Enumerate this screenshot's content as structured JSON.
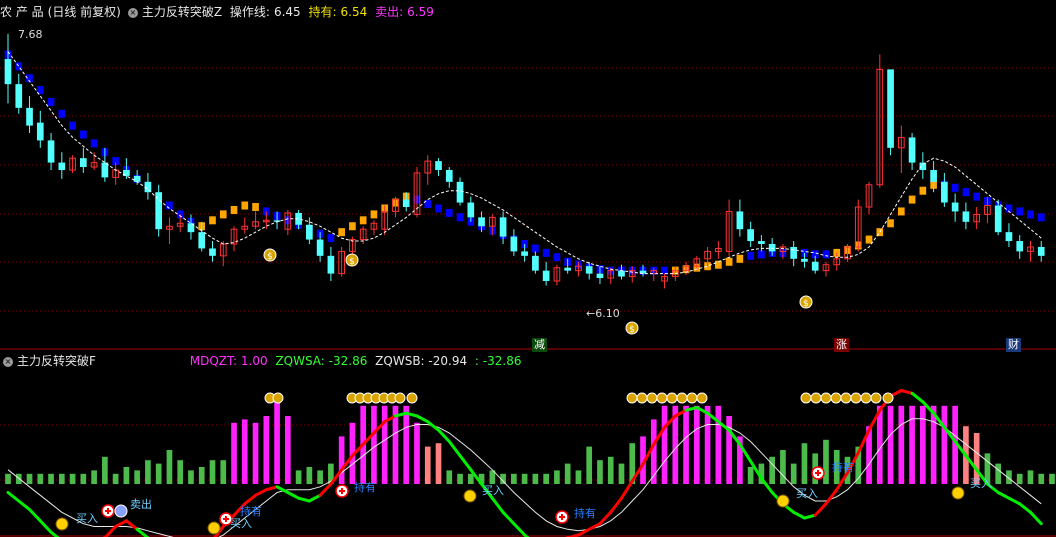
{
  "main_header": {
    "symbol": "农 产 品",
    "period": "(日线 前复权)",
    "indicator": "主力反转突破Z",
    "op_label": "操作线:",
    "op_value": "6.45",
    "hold_label": "持有:",
    "hold_value": "6.54",
    "sell_label": "卖出:",
    "sell_value": "6.59"
  },
  "sub_header": {
    "indicator": "主力反转突破F",
    "mdqzt": "MDQZT: 1.00",
    "zqwsa": "ZQWSA: -32.86",
    "zqwsb": "ZQWSB: -20.94",
    "extra": ": -32.86"
  },
  "annotations": {
    "high_price": "7.68",
    "low_price": "←6.10",
    "event_tags": [
      "减",
      "涨",
      "财"
    ],
    "buy": "买入",
    "sell": "卖出",
    "hold": "持有"
  },
  "colors": {
    "up": "#ff3333",
    "down": "#54ffff",
    "band_blue": "#0000ff",
    "band_orange": "#ffa500",
    "osc_red": "#ff0000",
    "osc_green": "#00ee00",
    "bar_green": "#4cbb4c",
    "bar_magenta": "#ff22ff",
    "bar_pink": "#ff8080",
    "grid": "#7a0000"
  },
  "chart_data": [
    {
      "type": "candlestick",
      "title": "主力反转突破Z",
      "ylim": [
        5.8,
        7.8
      ],
      "candles": [
        [
          7.55,
          7.72,
          7.25,
          7.38
        ],
        [
          7.38,
          7.45,
          7.18,
          7.22
        ],
        [
          7.22,
          7.3,
          7.05,
          7.1
        ],
        [
          7.12,
          7.2,
          6.95,
          7.0
        ],
        [
          7.0,
          7.05,
          6.8,
          6.85
        ],
        [
          6.85,
          6.92,
          6.74,
          6.8
        ],
        [
          6.8,
          6.9,
          6.78,
          6.88
        ],
        [
          6.88,
          6.95,
          6.78,
          6.82
        ],
        [
          6.82,
          6.92,
          6.8,
          6.85
        ],
        [
          6.85,
          6.95,
          6.72,
          6.75
        ],
        [
          6.75,
          6.85,
          6.7,
          6.8
        ],
        [
          6.8,
          6.88,
          6.74,
          6.76
        ],
        [
          6.76,
          6.8,
          6.7,
          6.72
        ],
        [
          6.72,
          6.78,
          6.6,
          6.65
        ],
        [
          6.65,
          6.7,
          6.35,
          6.4
        ],
        [
          6.4,
          6.48,
          6.3,
          6.42
        ],
        [
          6.42,
          6.5,
          6.38,
          6.44
        ],
        [
          6.44,
          6.5,
          6.33,
          6.38
        ],
        [
          6.38,
          6.45,
          6.25,
          6.27
        ],
        [
          6.27,
          6.32,
          6.18,
          6.22
        ],
        [
          6.22,
          6.32,
          6.15,
          6.3
        ],
        [
          6.3,
          6.42,
          6.25,
          6.4
        ],
        [
          6.4,
          6.48,
          6.37,
          6.42
        ],
        [
          6.42,
          6.52,
          6.4,
          6.45
        ],
        [
          6.45,
          6.52,
          6.4,
          6.46
        ],
        [
          6.46,
          6.52,
          6.4,
          6.45
        ],
        [
          6.4,
          6.53,
          6.36,
          6.51
        ],
        [
          6.51,
          6.53,
          6.4,
          6.43
        ],
        [
          6.43,
          6.48,
          6.3,
          6.33
        ],
        [
          6.33,
          6.38,
          6.18,
          6.22
        ],
        [
          6.22,
          6.28,
          6.05,
          6.1
        ],
        [
          6.1,
          6.28,
          6.08,
          6.25
        ],
        [
          6.25,
          6.35,
          6.22,
          6.33
        ],
        [
          6.33,
          6.42,
          6.3,
          6.4
        ],
        [
          6.4,
          6.46,
          6.36,
          6.44
        ],
        [
          6.4,
          6.56,
          6.36,
          6.52
        ],
        [
          6.52,
          6.62,
          6.48,
          6.6
        ],
        [
          6.6,
          6.65,
          6.52,
          6.55
        ],
        [
          6.5,
          6.82,
          6.48,
          6.78
        ],
        [
          6.78,
          6.9,
          6.7,
          6.86
        ],
        [
          6.86,
          6.88,
          6.76,
          6.8
        ],
        [
          6.8,
          6.82,
          6.68,
          6.72
        ],
        [
          6.72,
          6.75,
          6.56,
          6.58
        ],
        [
          6.58,
          6.62,
          6.45,
          6.48
        ],
        [
          6.48,
          6.52,
          6.38,
          6.42
        ],
        [
          6.42,
          6.5,
          6.36,
          6.48
        ],
        [
          6.48,
          6.52,
          6.3,
          6.35
        ],
        [
          6.35,
          6.4,
          6.22,
          6.25
        ],
        [
          6.25,
          6.3,
          6.18,
          6.22
        ],
        [
          6.22,
          6.25,
          6.1,
          6.12
        ],
        [
          6.12,
          6.18,
          6.02,
          6.05
        ],
        [
          6.05,
          6.16,
          6.02,
          6.14
        ],
        [
          6.14,
          6.2,
          6.1,
          6.12
        ],
        [
          6.12,
          6.18,
          6.08,
          6.15
        ],
        [
          6.15,
          6.18,
          6.06,
          6.1
        ],
        [
          6.1,
          6.15,
          6.03,
          6.07
        ],
        [
          6.07,
          6.14,
          6.03,
          6.12
        ],
        [
          6.12,
          6.16,
          6.06,
          6.08
        ],
        [
          6.08,
          6.15,
          6.04,
          6.12
        ],
        [
          6.12,
          6.16,
          6.08,
          6.1
        ],
        [
          6.1,
          6.14,
          6.05,
          6.12
        ],
        [
          6.05,
          6.1,
          6.0,
          6.08
        ],
        [
          6.08,
          6.15,
          6.05,
          6.12
        ],
        [
          6.12,
          6.18,
          6.09,
          6.15
        ],
        [
          6.15,
          6.22,
          6.12,
          6.2
        ],
        [
          6.2,
          6.28,
          6.15,
          6.25
        ],
        [
          6.25,
          6.32,
          6.2,
          6.27
        ],
        [
          6.25,
          6.6,
          6.22,
          6.52
        ],
        [
          6.52,
          6.6,
          6.35,
          6.4
        ],
        [
          6.4,
          6.45,
          6.28,
          6.32
        ],
        [
          6.32,
          6.36,
          6.25,
          6.3
        ],
        [
          6.3,
          6.34,
          6.22,
          6.25
        ],
        [
          6.25,
          6.3,
          6.2,
          6.28
        ],
        [
          6.28,
          6.32,
          6.15,
          6.2
        ],
        [
          6.2,
          6.24,
          6.14,
          6.18
        ],
        [
          6.18,
          6.22,
          6.1,
          6.12
        ],
        [
          6.12,
          6.18,
          6.08,
          6.16
        ],
        [
          6.16,
          6.24,
          6.12,
          6.2
        ],
        [
          6.2,
          6.3,
          6.18,
          6.28
        ],
        [
          6.28,
          6.6,
          6.25,
          6.55
        ],
        [
          6.55,
          6.72,
          6.5,
          6.7
        ],
        [
          6.7,
          7.58,
          6.68,
          7.48
        ],
        [
          7.48,
          7.4,
          6.9,
          6.95
        ],
        [
          6.95,
          7.1,
          6.78,
          7.02
        ],
        [
          7.02,
          7.05,
          6.8,
          6.85
        ],
        [
          6.85,
          6.92,
          6.74,
          6.8
        ],
        [
          6.8,
          6.86,
          6.65,
          6.72
        ],
        [
          6.72,
          6.78,
          6.55,
          6.58
        ],
        [
          6.58,
          6.64,
          6.45,
          6.52
        ],
        [
          6.52,
          6.58,
          6.4,
          6.45
        ],
        [
          6.45,
          6.55,
          6.4,
          6.5
        ],
        [
          6.5,
          6.62,
          6.44,
          6.56
        ],
        [
          6.56,
          6.6,
          6.36,
          6.38
        ],
        [
          6.38,
          6.44,
          6.28,
          6.32
        ],
        [
          6.32,
          6.36,
          6.2,
          6.25
        ],
        [
          6.25,
          6.32,
          6.18,
          6.28
        ],
        [
          6.28,
          6.32,
          6.18,
          6.22
        ]
      ],
      "band": [
        7.58,
        7.5,
        7.42,
        7.34,
        7.26,
        7.18,
        7.1,
        7.04,
        6.98,
        6.92,
        6.86,
        6.8,
        6.74,
        6.68,
        6.62,
        6.56,
        6.5,
        6.45,
        6.42,
        6.46,
        6.5,
        6.53,
        6.56,
        6.55,
        6.52,
        6.49,
        6.46,
        6.43,
        6.4,
        6.37,
        6.34,
        6.38,
        6.42,
        6.46,
        6.5,
        6.54,
        6.58,
        6.62,
        6.6,
        6.57,
        6.54,
        6.51,
        6.48,
        6.45,
        6.42,
        6.39,
        6.36,
        6.33,
        6.3,
        6.27,
        6.24,
        6.21,
        6.18,
        6.16,
        6.14,
        6.13,
        6.12,
        6.12,
        6.12,
        6.12,
        6.12,
        6.12,
        6.12,
        6.13,
        6.14,
        6.15,
        6.16,
        6.18,
        6.2,
        6.22,
        6.23,
        6.24,
        6.24,
        6.24,
        6.24,
        6.23,
        6.23,
        6.24,
        6.26,
        6.29,
        6.33,
        6.38,
        6.44,
        6.52,
        6.6,
        6.66,
        6.7,
        6.7,
        6.68,
        6.65,
        6.62,
        6.59,
        6.56,
        6.54,
        6.52,
        6.5,
        6.48
      ],
      "band_mode": [
        -1,
        -1,
        -1,
        -1,
        -1,
        -1,
        -1,
        -1,
        -1,
        -1,
        -1,
        -1,
        -1,
        -1,
        -1,
        -1,
        -1,
        -1,
        1,
        1,
        1,
        1,
        1,
        1,
        -1,
        -1,
        -1,
        -1,
        -1,
        -1,
        -1,
        1,
        1,
        1,
        1,
        1,
        1,
        1,
        -1,
        -1,
        -1,
        -1,
        -1,
        -1,
        -1,
        -1,
        -1,
        -1,
        -1,
        -1,
        -1,
        -1,
        -1,
        -1,
        -1,
        -1,
        -1,
        -1,
        -1,
        -1,
        -1,
        -1,
        1,
        1,
        1,
        1,
        1,
        1,
        1,
        -1,
        -1,
        -1,
        -1,
        -1,
        -1,
        -1,
        -1,
        1,
        1,
        1,
        1,
        1,
        1,
        1,
        1,
        1,
        1,
        -1,
        -1,
        -1,
        -1,
        -1,
        -1,
        -1,
        -1,
        -1,
        -1
      ],
      "ma": [
        7.6,
        7.5,
        7.4,
        7.3,
        7.2,
        7.1,
        7.02,
        6.96,
        6.9,
        6.85,
        6.8,
        6.76,
        6.72,
        6.67,
        6.6,
        6.54,
        6.49,
        6.44,
        6.39,
        6.34,
        6.3,
        6.31,
        6.34,
        6.38,
        6.42,
        6.45,
        6.47,
        6.47,
        6.45,
        6.42,
        6.38,
        6.34,
        6.32,
        6.32,
        6.34,
        6.38,
        6.43,
        6.48,
        6.54,
        6.6,
        6.64,
        6.66,
        6.66,
        6.64,
        6.61,
        6.57,
        6.53,
        6.48,
        6.43,
        6.38,
        6.33,
        6.28,
        6.24,
        6.2,
        6.17,
        6.15,
        6.13,
        6.12,
        6.11,
        6.1,
        6.1,
        6.1,
        6.1,
        6.11,
        6.13,
        6.15,
        6.18,
        6.21,
        6.24,
        6.26,
        6.27,
        6.27,
        6.27,
        6.26,
        6.25,
        6.24,
        6.22,
        6.21,
        6.21,
        6.23,
        6.28,
        6.38,
        6.5,
        6.62,
        6.74,
        6.84,
        6.88,
        6.86,
        6.82,
        6.76,
        6.7,
        6.64,
        6.58,
        6.52,
        6.46,
        6.4,
        6.34
      ],
      "annotations": [
        "7.68",
        "←6.10"
      ]
    },
    {
      "type": "bar",
      "title": "主力反转突破F",
      "ylim": [
        -100,
        100
      ],
      "bars": [
        6,
        6,
        6,
        6,
        6,
        6,
        6,
        6,
        8,
        16,
        6,
        10,
        8,
        14,
        12,
        20,
        14,
        8,
        10,
        14,
        14,
        36,
        38,
        36,
        40,
        50,
        40,
        8,
        10,
        8,
        12,
        28,
        36,
        46,
        46,
        46,
        46,
        46,
        36,
        22,
        24,
        8,
        6,
        6,
        6,
        8,
        6,
        6,
        6,
        6,
        6,
        8,
        12,
        8,
        22,
        14,
        16,
        12,
        24,
        28,
        38,
        46,
        46,
        46,
        46,
        46,
        46,
        40,
        28,
        10,
        12,
        16,
        20,
        12,
        24,
        18,
        26,
        20,
        16,
        22,
        34,
        46,
        46,
        46,
        46,
        46,
        46,
        46,
        46,
        34,
        30,
        18,
        12,
        8,
        6,
        8,
        6,
        6
      ],
      "bar_kind": [
        0,
        0,
        0,
        0,
        0,
        0,
        0,
        0,
        0,
        0,
        0,
        0,
        0,
        0,
        0,
        0,
        0,
        0,
        0,
        0,
        0,
        1,
        1,
        1,
        1,
        1,
        1,
        0,
        0,
        0,
        0,
        1,
        1,
        1,
        1,
        1,
        1,
        1,
        1,
        2,
        2,
        0,
        0,
        0,
        0,
        0,
        0,
        0,
        0,
        0,
        0,
        0,
        0,
        0,
        0,
        0,
        0,
        0,
        0,
        1,
        1,
        1,
        1,
        1,
        1,
        1,
        1,
        1,
        1,
        0,
        0,
        0,
        0,
        0,
        0,
        0,
        0,
        0,
        0,
        0,
        1,
        1,
        1,
        1,
        1,
        1,
        1,
        1,
        1,
        2,
        2,
        0,
        0,
        0,
        0,
        0,
        0,
        0
      ],
      "osc": [
        -6,
        -12,
        -18,
        -26,
        -34,
        -40,
        -44,
        -46,
        -42,
        -38,
        -30,
        -26,
        -32,
        -38,
        -42,
        -46,
        -48,
        -48,
        -46,
        -40,
        -30,
        -22,
        -14,
        -8,
        -4,
        -2,
        -6,
        -10,
        -12,
        -8,
        0,
        10,
        20,
        28,
        36,
        44,
        48,
        50,
        48,
        44,
        38,
        30,
        20,
        10,
        0,
        -10,
        -20,
        -28,
        -36,
        -42,
        -44,
        -40,
        -38,
        -36,
        -32,
        -28,
        -20,
        -10,
        2,
        14,
        28,
        40,
        48,
        52,
        54,
        50,
        44,
        38,
        28,
        16,
        4,
        -6,
        -14,
        -20,
        -24,
        -22,
        -14,
        -4,
        8,
        22,
        38,
        52,
        62,
        66,
        64,
        58,
        50,
        40,
        30,
        20,
        10,
        0,
        -6,
        -10,
        -14,
        -20,
        -28
      ],
      "osc_trend": [
        1,
        1,
        1,
        1,
        1,
        1,
        1,
        1,
        1,
        1,
        2,
        2,
        2,
        1,
        1,
        1,
        1,
        1,
        1,
        1,
        2,
        2,
        2,
        2,
        2,
        2,
        1,
        1,
        1,
        1,
        2,
        2,
        2,
        2,
        2,
        2,
        2,
        1,
        1,
        1,
        1,
        1,
        1,
        1,
        1,
        1,
        1,
        1,
        1,
        1,
        1,
        2,
        2,
        2,
        2,
        2,
        2,
        2,
        2,
        2,
        2,
        2,
        2,
        2,
        1,
        1,
        1,
        1,
        1,
        1,
        1,
        1,
        1,
        1,
        1,
        1,
        2,
        2,
        2,
        2,
        2,
        2,
        2,
        2,
        2,
        1,
        1,
        1,
        1,
        1,
        1,
        1,
        1,
        1,
        1,
        1,
        1
      ],
      "osc_slow": [
        10,
        4,
        -2,
        -8,
        -14,
        -20,
        -24,
        -28,
        -30,
        -30,
        -30,
        -30,
        -31,
        -33,
        -35,
        -37,
        -39,
        -41,
        -42,
        -40,
        -36,
        -30,
        -24,
        -18,
        -12,
        -6,
        -4,
        -4,
        -4,
        -2,
        2,
        8,
        14,
        20,
        26,
        31,
        36,
        40,
        42,
        42,
        40,
        36,
        30,
        24,
        17,
        10,
        2,
        -6,
        -13,
        -20,
        -26,
        -30,
        -32,
        -33,
        -32,
        -30,
        -26,
        -20,
        -12,
        -4,
        6,
        16,
        25,
        33,
        39,
        42,
        42,
        40,
        36,
        30,
        22,
        14,
        6,
        -2,
        -8,
        -12,
        -12,
        -9,
        -4,
        4,
        14,
        25,
        35,
        42,
        46,
        46,
        44,
        40,
        34,
        28,
        22,
        16,
        10,
        4,
        -2,
        -8,
        -14
      ],
      "annotations": [
        "买入",
        "卖出",
        "持有"
      ]
    }
  ]
}
